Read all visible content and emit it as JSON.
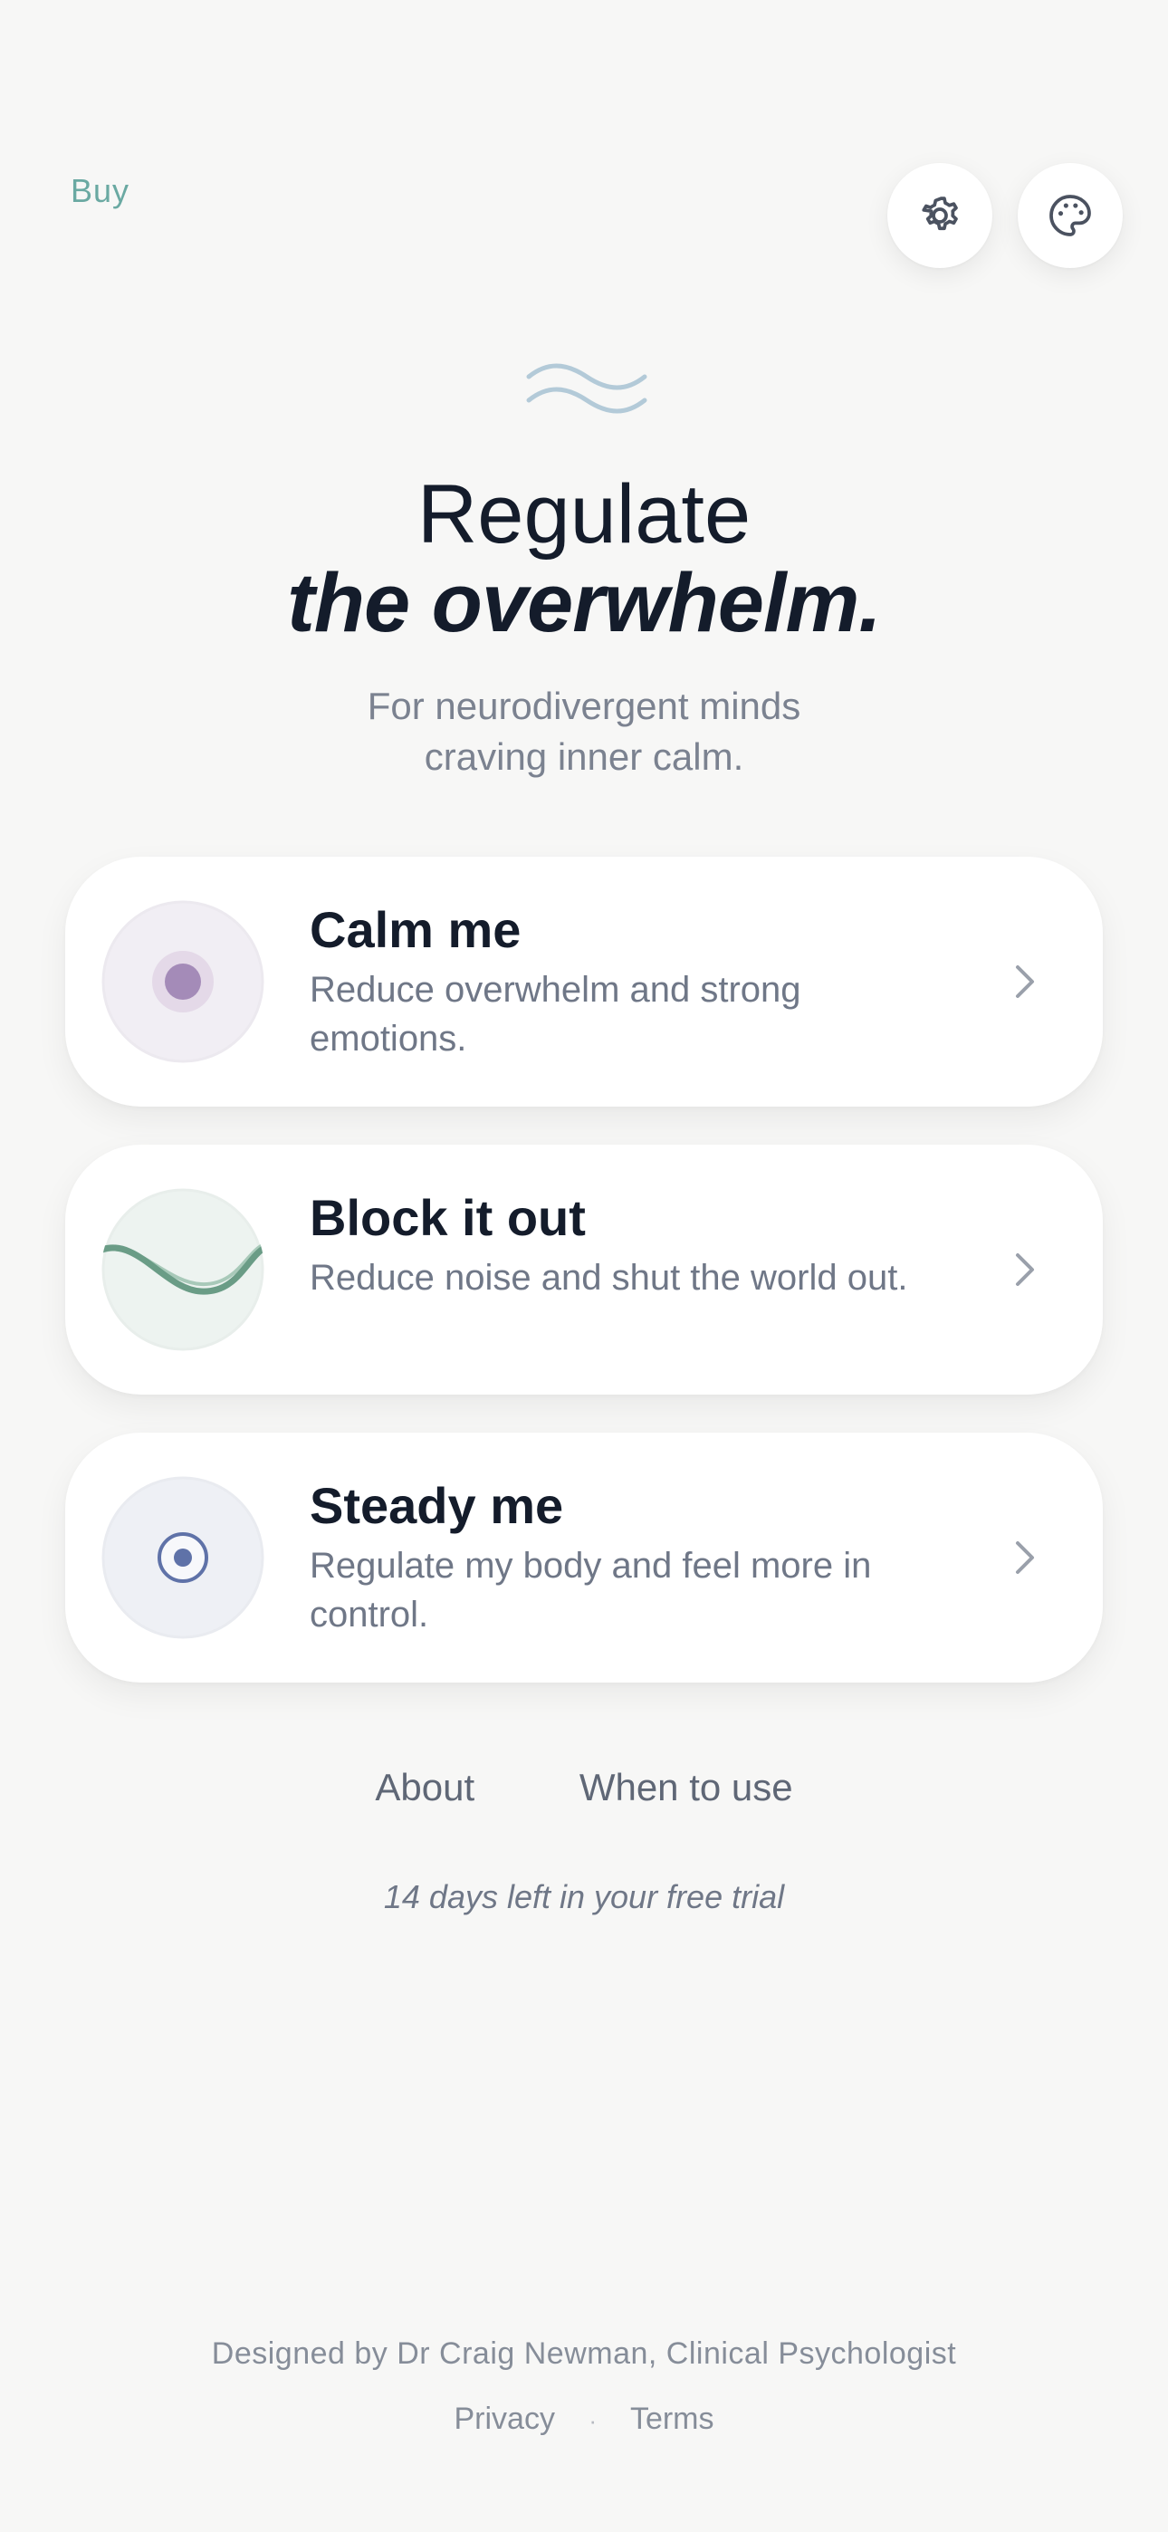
{
  "header": {
    "buy_label": "Buy",
    "settings_icon": "gear-icon",
    "theme_icon": "palette-icon"
  },
  "hero": {
    "logo_icon": "waves-icon",
    "title_line1": "Regulate",
    "title_line2": "the overwhelm.",
    "subtitle_line1": "For neurodivergent minds",
    "subtitle_line2": "craving inner calm."
  },
  "cards": [
    {
      "title": "Calm me",
      "description": "Reduce overwhelm and strong emotions.",
      "icon": "calm-dot-icon",
      "accent": "#a48bb8"
    },
    {
      "title": "Block it out",
      "description": "Reduce noise and shut the world out.",
      "icon": "wave-line-icon",
      "accent": "#6a9c86"
    },
    {
      "title": "Steady me",
      "description": "Regulate my body and feel more in control.",
      "icon": "steady-target-icon",
      "accent": "#5f72a8"
    }
  ],
  "links": {
    "about": "About",
    "when_to_use": "When to use"
  },
  "trial_text": "14 days left in your free trial",
  "footer": {
    "designed_by": "Designed by Dr Craig Newman, Clinical Psychologist",
    "privacy": "Privacy",
    "separator": "·",
    "terms": "Terms"
  },
  "colors": {
    "background": "#f7f7f6",
    "buy": "#6aa9a2",
    "title": "#141c2b",
    "muted": "#7b8290"
  }
}
